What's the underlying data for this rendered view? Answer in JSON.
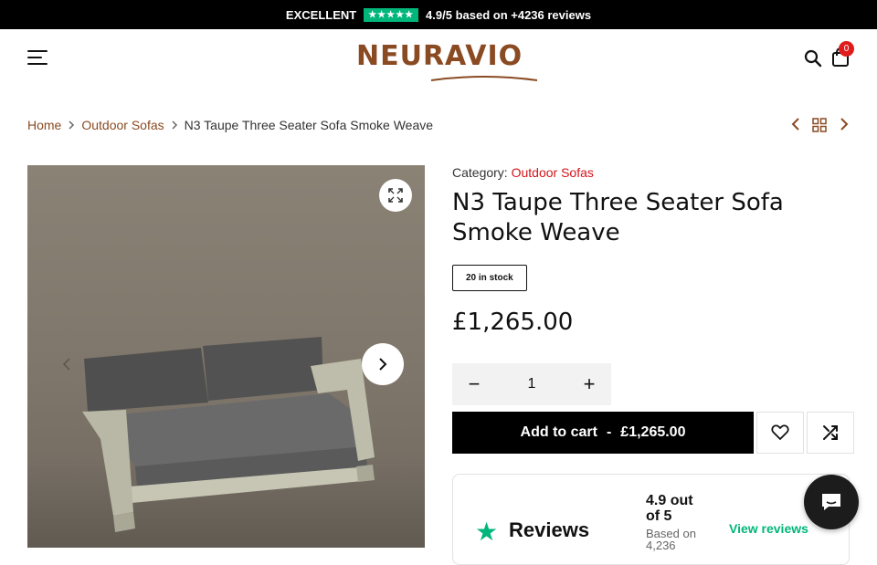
{
  "topbar": {
    "rating_word": "EXCELLENT",
    "stars": "★★★★★",
    "rating_text": "4.9/5 based on +4236 reviews"
  },
  "header": {
    "logo": "NEURAVIO",
    "cart_count": "0"
  },
  "breadcrumb": {
    "items": [
      "Home",
      "Outdoor Sofas",
      "N3 Taupe Three Seater Sofa Smoke Weave"
    ]
  },
  "product": {
    "category_label": "Category:",
    "category": "Outdoor Sofas",
    "title": "N3 Taupe Three Seater Sofa Smoke Weave",
    "stock": "20 in stock",
    "price": "£1,265.00",
    "quantity": "1",
    "add_to_cart": "Add to cart",
    "add_to_cart_sep": "-",
    "add_to_cart_price": "£1,265.00"
  },
  "reviews": {
    "label": "Reviews",
    "score": "4.9 out of 5",
    "based_on": "Based on 4,236",
    "link": "View reviews"
  },
  "colors": {
    "accent": "#8a4a22",
    "category": "#d2141b",
    "trustpilot": "#00b67a",
    "badge": "#e01b1b"
  },
  "icons": [
    "hamburger-icon",
    "search-icon",
    "cart-icon",
    "chevron-left-icon",
    "grid-icon",
    "chevron-right-icon",
    "expand-icon",
    "heart-icon",
    "compare-icon",
    "chat-icon"
  ]
}
